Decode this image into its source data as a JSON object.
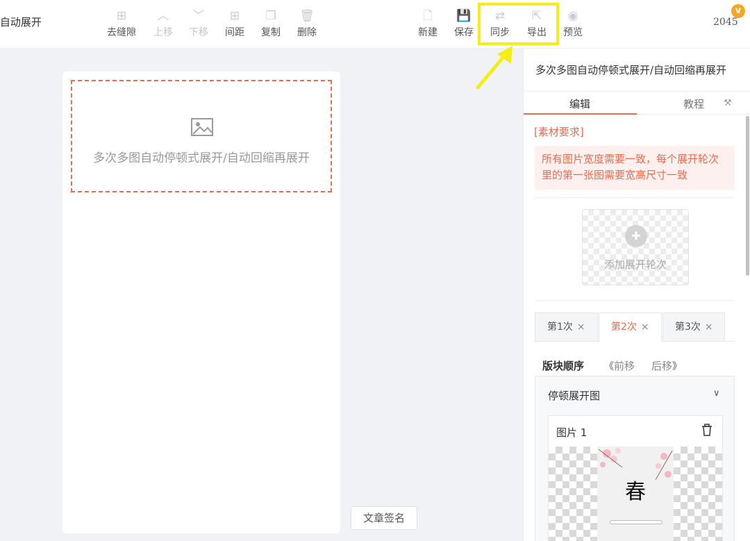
{
  "app": {
    "doc_title": "]自动展开",
    "counter": "2045",
    "vip_badge": "v"
  },
  "toolbar": {
    "left_tools": [
      {
        "label": "去缝隙",
        "icon": "plus-box-icon",
        "state": "active"
      },
      {
        "label": "上移",
        "icon": "chevron-up-icon",
        "state": "muted"
      },
      {
        "label": "下移",
        "icon": "chevron-down-icon",
        "state": "muted"
      },
      {
        "label": "间距",
        "icon": "plus-box-icon",
        "state": "active"
      },
      {
        "label": "复制",
        "icon": "copy-icon",
        "state": "active"
      },
      {
        "label": "删除",
        "icon": "trash-icon",
        "state": "active"
      }
    ],
    "right_tools": [
      {
        "label": "新建",
        "icon": "new-file-icon"
      },
      {
        "label": "保存",
        "icon": "save-icon"
      },
      {
        "label": "同步",
        "icon": "sync-icon"
      },
      {
        "label": "导出",
        "icon": "export-icon"
      },
      {
        "label": "预览",
        "icon": "eye-icon"
      }
    ],
    "highlight_color": "#f5ee16"
  },
  "canvas": {
    "block_placeholder": "多次多图自动停顿式展开/自动回缩再展开",
    "accent_color": "#ee6a4c",
    "sign_button": "文章签名"
  },
  "panel": {
    "title": "多次多图自动停顿式展开/自动回缩再展开",
    "tabs": [
      "编辑",
      "教程"
    ],
    "material_title": "[素材要求]",
    "material_text": "所有图片宽度需要一致，每个展开轮次里的第一张图需要宽高尺寸一致",
    "add_round": "添加展开轮次",
    "rounds": [
      {
        "label": "第1次",
        "active": false
      },
      {
        "label": "第2次",
        "active": true
      },
      {
        "label": "第3次",
        "active": false
      }
    ],
    "close_glyph": "×",
    "order_label": "版块顺序",
    "move_prev": "前移",
    "move_next": "后移",
    "block_title": "停顿展开图",
    "image_label": "图片 1",
    "spring_char": "春"
  }
}
